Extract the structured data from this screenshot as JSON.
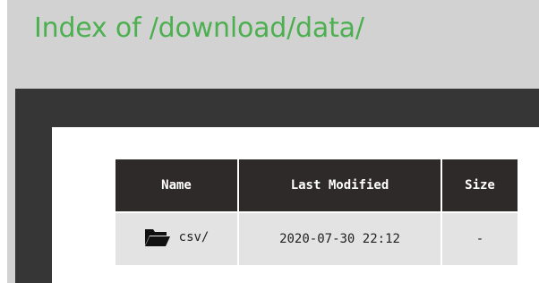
{
  "page": {
    "title": "Index of /download/data/",
    "title_color": "#4caf50"
  },
  "colors": {
    "header_bar": "#d2d2d2",
    "frame": "#363636",
    "table_header_bg": "#2f2a2a",
    "table_row_bg": "#e3e3e3"
  },
  "table": {
    "columns": [
      "Name",
      "Last Modified",
      "Size"
    ],
    "rows": [
      {
        "icon": "folder-icon",
        "name": "csv/",
        "last_modified": "2020-07-30 22:12",
        "size": "-"
      }
    ]
  }
}
